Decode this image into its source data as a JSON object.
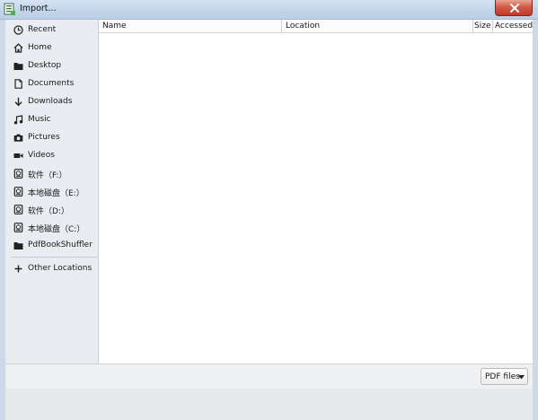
{
  "window": {
    "title": "Import...",
    "close_icon": "close-icon",
    "app_icon": "app-icon"
  },
  "sidebar": {
    "items": [
      {
        "label": "Recent",
        "icon": "recent-icon"
      },
      {
        "label": "Home",
        "icon": "home-icon"
      },
      {
        "label": "Desktop",
        "icon": "folder-icon"
      },
      {
        "label": "Documents",
        "icon": "document-icon"
      },
      {
        "label": "Downloads",
        "icon": "download-icon"
      },
      {
        "label": "Music",
        "icon": "music-icon"
      },
      {
        "label": "Pictures",
        "icon": "camera-icon"
      },
      {
        "label": "Videos",
        "icon": "video-icon"
      },
      {
        "label": "软件（F:）",
        "icon": "drive-icon"
      },
      {
        "label": "本地磁盘（E:）",
        "icon": "drive-icon"
      },
      {
        "label": "软件（D:）",
        "icon": "drive-icon"
      },
      {
        "label": "本地磁盘（C:）",
        "icon": "drive-icon"
      },
      {
        "label": "PdfBookShuffler",
        "icon": "folder-icon"
      },
      {
        "label": "Other Locations",
        "icon": "plus-icon"
      }
    ]
  },
  "file_list": {
    "columns": [
      "Name",
      "Location",
      "Size",
      "Accessed"
    ]
  },
  "bottom_bar": {
    "filter_label": "PDF files",
    "filter_icon": "dropdown-arrow-icon"
  }
}
